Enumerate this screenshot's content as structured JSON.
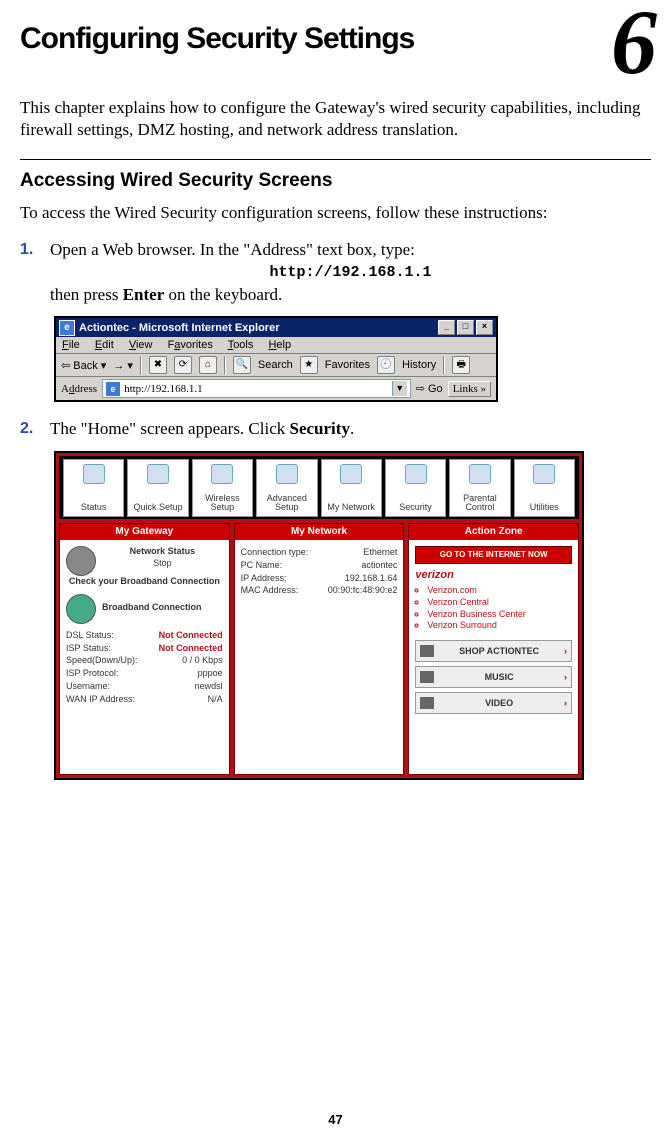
{
  "chapter_number": "6",
  "title": "Configuring Security Settings",
  "intro": "This chapter explains how to configure the Gateway's wired security capabilities, including firewall settings, DMZ hosting, and network address translation.",
  "section_heading": "Accessing Wired Security Screens",
  "section_lead": "To access the Wired Security configuration screens, follow these instructions:",
  "step1_a": "Open a Web browser. In the \"Address\" text box, type:",
  "step1_url": "http://192.168.1.1",
  "step1_b_pre": "then press ",
  "step1_b_key": "Enter",
  "step1_b_post": " on the keyboard.",
  "step2_pre": "The \"Home\" screen appears. Click ",
  "step2_key": "Security",
  "step2_post": ".",
  "ie": {
    "title": "Actiontec - Microsoft Internet Explorer",
    "icon_glyph": "e",
    "min": "_",
    "max": "□",
    "close": "×",
    "menu": {
      "file": "File",
      "edit": "Edit",
      "view": "View",
      "favorites": "Favorites",
      "tools": "Tools",
      "help": "Help"
    },
    "tool": {
      "back": "Back",
      "search": "Search",
      "favorites": "Favorites",
      "history": "History"
    },
    "addr_label": "Address",
    "addr_url": "http://192.168.1.1",
    "go": "Go",
    "links": "Links"
  },
  "router": {
    "nav": [
      "Status",
      "Quick Setup",
      "Wireless Setup",
      "Advanced Setup",
      "My Network",
      "Security",
      "Parental Control",
      "Utilities"
    ],
    "panel_titles": [
      "My Gateway",
      "My Network",
      "Action Zone"
    ],
    "gateway": {
      "heading": "Network Status",
      "stop": "Stop",
      "check": "Check your Broadband Connection",
      "bbc": "Broadband Connection",
      "rows": [
        {
          "l": "DSL Status:",
          "v": "Not Connected",
          "red": true
        },
        {
          "l": "ISP Status:",
          "v": "Not Connected",
          "red": true
        },
        {
          "l": "Speed(Down/Up):",
          "v": "0 / 0 Kbps"
        },
        {
          "l": "ISP Protocol:",
          "v": "pppoe"
        },
        {
          "l": "Username:",
          "v": "newdsl"
        },
        {
          "l": "WAN IP Address:",
          "v": "N/A"
        }
      ]
    },
    "network": {
      "rows": [
        {
          "l": "Connection type:",
          "v": "Ethernet"
        },
        {
          "l": "PC Name:",
          "v": "actiontec"
        },
        {
          "l": "IP Address:",
          "v": "192.168.1.64"
        },
        {
          "l": "MAC Address:",
          "v": "00:90:fc:48:90:e2"
        }
      ]
    },
    "action": {
      "cta": "GO TO THE INTERNET NOW",
      "logo": "verizon",
      "links": [
        "Verizon.com",
        "Verizon Central",
        "Verizon Business Center",
        "Verizon Surround"
      ],
      "media": [
        {
          "label": "SHOP ACTIONTEC"
        },
        {
          "label": "MUSIC"
        },
        {
          "label": "VIDEO"
        }
      ]
    }
  },
  "page_number": "47"
}
